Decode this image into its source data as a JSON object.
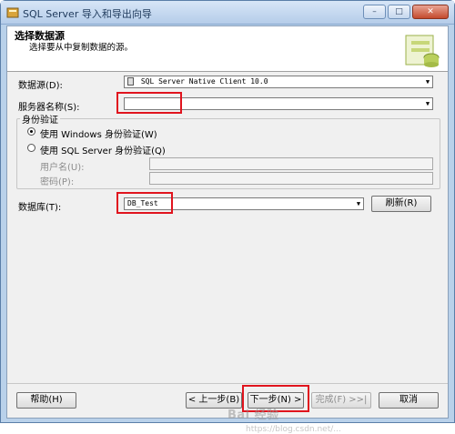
{
  "window": {
    "title": "SQL Server 导入和导出向导",
    "controls": {
      "minimize": "–",
      "maximize": "□",
      "close": "✕"
    }
  },
  "header": {
    "title": "选择数据源",
    "subtitle": "选择要从中复制数据的源。"
  },
  "form": {
    "datasource_label": "数据源(D):",
    "datasource_value": "SQL Server Native Client 10.0",
    "server_label": "服务器名称(S):",
    "server_value": "",
    "auth_group_label": "身份验证",
    "auth_windows": "使用 Windows 身份验证(W)",
    "auth_sql": "使用 SQL Server 身份验证(Q)",
    "username_label": "用户名(U):",
    "password_label": "密码(P):",
    "database_label": "数据库(T):",
    "database_value": "DB_Test",
    "refresh_button": "刷新(R)"
  },
  "footer": {
    "help": "帮助(H)",
    "back": "< 上一步(B)",
    "next": "下一步(N) >",
    "finish": "完成(F) >>|",
    "cancel": "取消"
  },
  "watermark": {
    "brand": "Bai 经验",
    "url": "https://blog.csdn.net/..."
  },
  "colors": {
    "highlight": "#e0141e",
    "title_text": "#1e395b"
  }
}
